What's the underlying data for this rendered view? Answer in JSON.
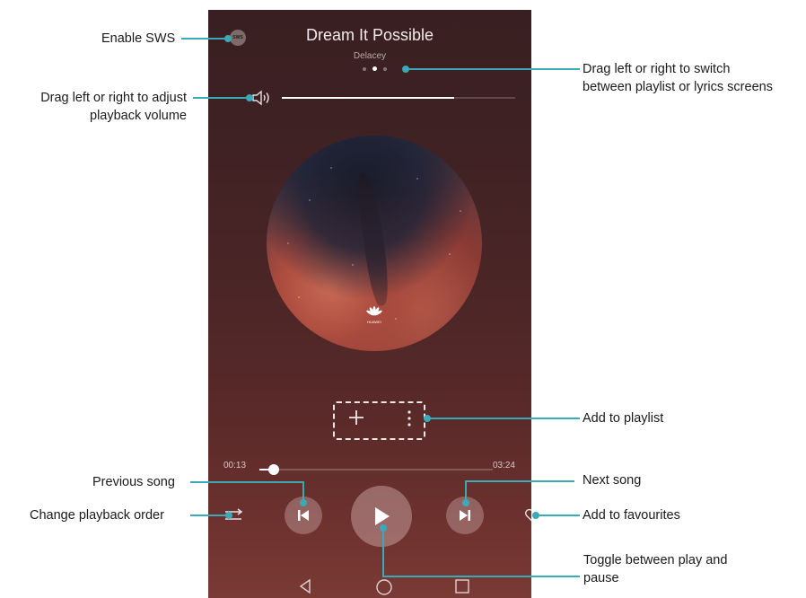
{
  "player": {
    "sws_label": "SWS",
    "song_title": "Dream It Possible",
    "artist": "Delacey",
    "page_dots": 3,
    "active_dot": 1,
    "volume_level": 0.74,
    "album_logo_text": "HUAWEI",
    "current_time": "00:13",
    "total_time": "03:24",
    "progress": 0.06,
    "add_icon": "plus-icon",
    "more_icon": "more-vertical-icon",
    "prev_icon": "skip-previous-icon",
    "play_icon": "play-icon",
    "next_icon": "skip-next-icon",
    "order_icon": "shuffle-order-icon",
    "fav_icon": "heart-outline-icon"
  },
  "nav": {
    "back_icon": "back-triangle-icon",
    "home_icon": "home-circle-icon",
    "recent_icon": "recent-square-icon"
  },
  "callouts": {
    "enable_sws": "Enable SWS",
    "volume_line1": "Drag left or right to adjust",
    "volume_line2": "playback volume",
    "switch_line1": "Drag left or right to switch",
    "switch_line2": "between playlist or lyrics screens",
    "add_playlist": "Add to playlist",
    "previous_song": "Previous song",
    "next_song": "Next song",
    "change_order": "Change playback order",
    "add_favourites": "Add to favourites",
    "toggle_line1": "Toggle between play and",
    "toggle_line2": "pause"
  },
  "colors": {
    "callout_line": "#3aa9b8",
    "background_top": "#3a1f22",
    "background_bottom": "#7a3a35"
  }
}
